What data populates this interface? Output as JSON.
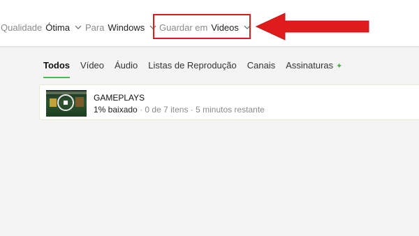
{
  "options": {
    "quality": {
      "label": "Qualidade",
      "value": "Ótima"
    },
    "platform": {
      "label": "Para",
      "value": "Windows"
    },
    "save": {
      "label": "Guardar em",
      "value": "Videos"
    }
  },
  "annotation": {
    "color": "#e01b1b"
  },
  "tabs": [
    {
      "label": "Todos",
      "active": true
    },
    {
      "label": "Vídeo"
    },
    {
      "label": "Áudio"
    },
    {
      "label": "Listas de Reprodução"
    },
    {
      "label": "Canais"
    },
    {
      "label": "Assinaturas",
      "icon": "sparkle-icon"
    }
  ],
  "accent_color": "#44c041",
  "download": {
    "title": "GAMEPLAYS",
    "progress_text": "1% baixado",
    "items_text": "0 de 7 itens",
    "remaining_text": "5 minutos restante",
    "progress_percent": 1
  }
}
